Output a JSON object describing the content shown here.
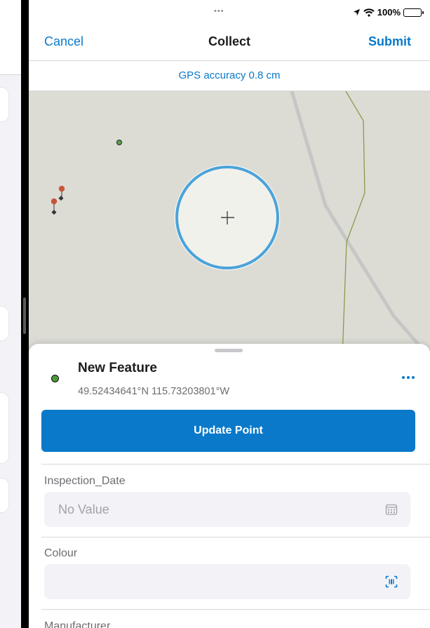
{
  "status_bar": {
    "dots": "•••",
    "battery_text": "100%"
  },
  "nav": {
    "cancel_label": "Cancel",
    "title": "Collect",
    "submit_label": "Submit"
  },
  "gps": {
    "accuracy_text": "GPS accuracy 0.8 cm"
  },
  "feature": {
    "title": "New Feature",
    "coordinates": "49.52434641°N  115.73203801°W",
    "dot_color": "#4c9a3a"
  },
  "actions": {
    "update_point_label": "Update Point"
  },
  "form": {
    "fields": [
      {
        "label": "Inspection_Date",
        "value": "No Value",
        "icon": "calendar-icon"
      },
      {
        "label": "Colour",
        "value": "",
        "icon": "barcode-scan-icon"
      },
      {
        "label": "Manufacturer"
      }
    ]
  },
  "colors": {
    "accent": "#0a79c9",
    "map_background": "#dcdcd5",
    "crosshair_ring": "#4aa3d9",
    "feature_marker": "#c8553a"
  }
}
